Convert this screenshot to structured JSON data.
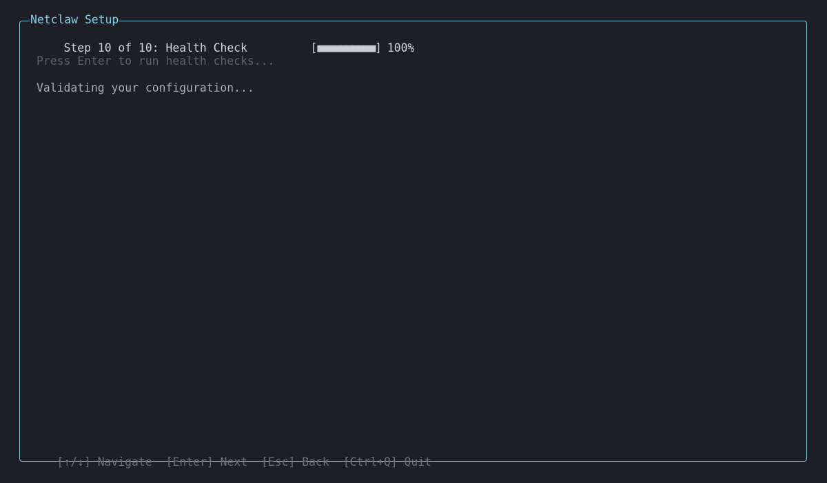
{
  "app": {
    "title": "Netclaw Setup"
  },
  "step": {
    "title": "Step 10 of 10: Health Check",
    "progress_open": "[",
    "progress_fill": "■■■■■■■■■■",
    "progress_close": "]",
    "progress_fraction": 1.0,
    "progress_percent_label": "100%"
  },
  "content": {
    "prompt": "Press Enter to run health checks...",
    "status": "Validating your configuration..."
  },
  "footer": {
    "hints": [
      "[↑/↓] Navigate",
      "[Enter] Next",
      "[Esc] Back",
      "[Ctrl+Q] Quit"
    ]
  },
  "colors": {
    "background": "#1e1e26",
    "border": "#7fc4d9",
    "title": "#7fd3ea",
    "text": "#d2d5dc",
    "muted": "#5f636d",
    "footer": "#6b6f78"
  }
}
